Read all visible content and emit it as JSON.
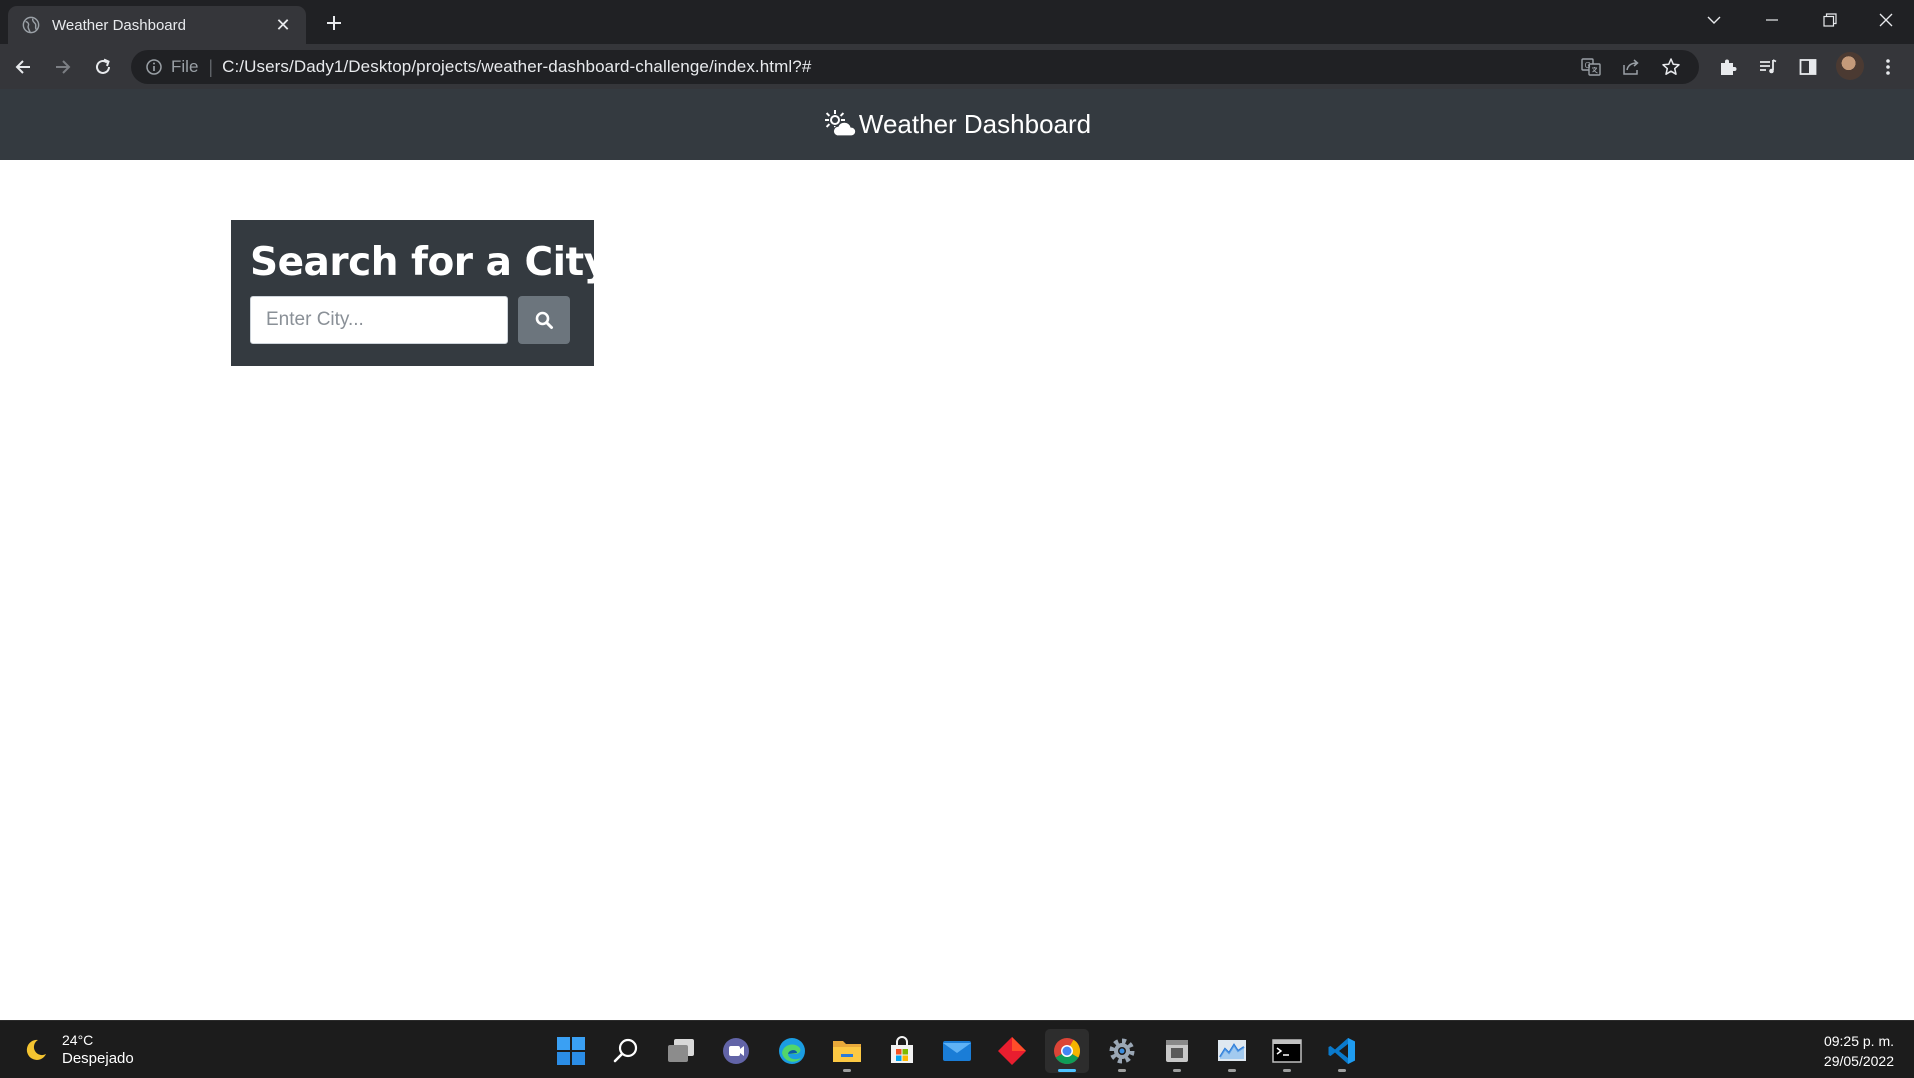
{
  "browser": {
    "tab_title": "Weather Dashboard",
    "tab_close_glyph": "✕",
    "url_scheme": "File",
    "url": "C:/Users/Dady1/Desktop/projects/weather-dashboard-challenge/index.html?#"
  },
  "page": {
    "header_title": "Weather Dashboard",
    "header_icon": "cloud-sun-icon",
    "search": {
      "heading": "Search for a City:",
      "placeholder": "Enter City...",
      "value": ""
    },
    "colors": {
      "header_bg": "#343a40",
      "search_button_bg": "#6c757d"
    }
  },
  "taskbar": {
    "weather_temp": "24°C",
    "weather_condition": "Despejado",
    "apps": [
      "start",
      "search",
      "task-view",
      "teams-chat",
      "edge",
      "file-explorer",
      "microsoft-store",
      "mail",
      "git-kraken",
      "chrome",
      "settings",
      "app-window",
      "performance-monitor",
      "terminal",
      "vs-code"
    ],
    "time": "09:25 p. m.",
    "date": "29/05/2022"
  }
}
